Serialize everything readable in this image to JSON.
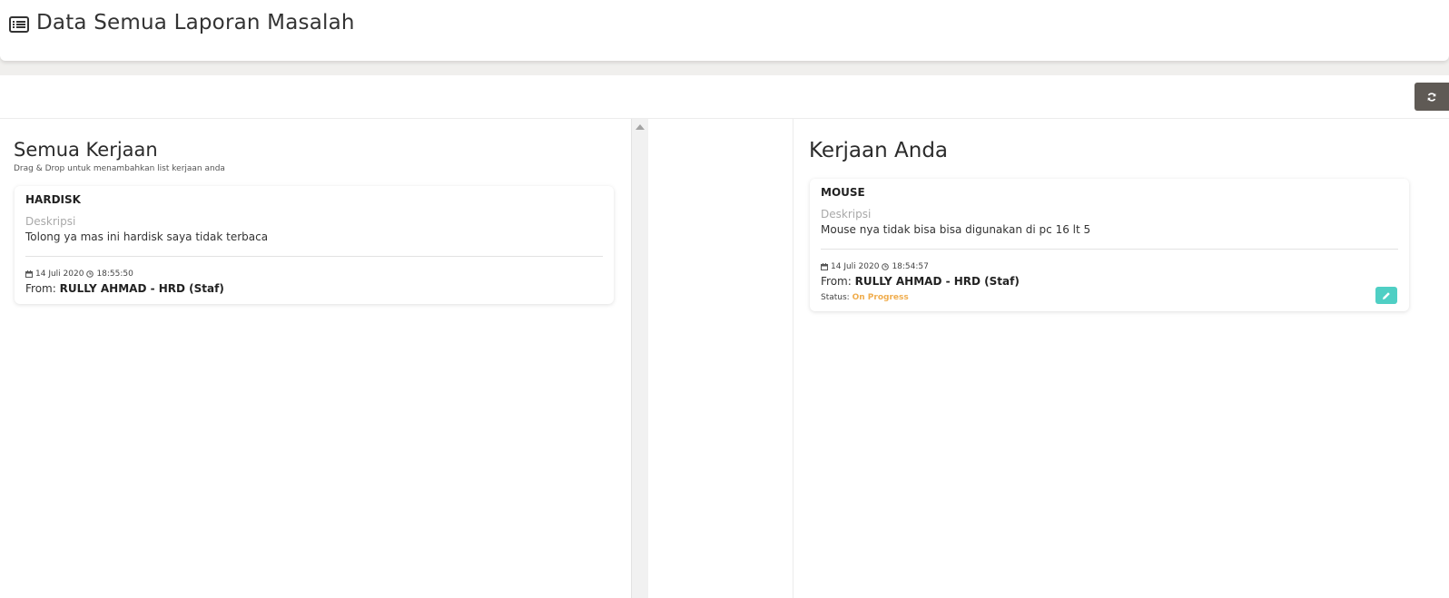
{
  "header": {
    "title": "Data Semua Laporan Masalah",
    "icon": "list-icon"
  },
  "toolbar": {
    "refresh_icon": "refresh-icon"
  },
  "left_panel": {
    "title": "Semua Kerjaan",
    "subtitle": "Drag & Drop untuk menambahkan list kerjaan anda",
    "cards": [
      {
        "title": "HARDISK",
        "desc_label": "Deskripsi",
        "description": "Tolong ya mas ini hardisk saya tidak terbaca",
        "date": "14 Juli 2020",
        "time": "18:55:50",
        "from_label": "From:",
        "from_name": "RULLY AHMAD - HRD (Staf)"
      }
    ]
  },
  "right_panel": {
    "title": "Kerjaan Anda",
    "cards": [
      {
        "title": "MOUSE",
        "desc_label": "Deskripsi",
        "description": "Mouse nya tidak bisa bisa digunakan di pc 16 lt 5",
        "date": "14 Juli 2020",
        "time": "18:54:57",
        "from_label": "From:",
        "from_name": "RULLY AHMAD - HRD (Staf)",
        "status_label": "Status:",
        "status_value": "On Progress",
        "status_color": "#f0ad4e"
      }
    ]
  },
  "colors": {
    "accent_edit": "#4fcfc4",
    "refresh_bg": "#5f5a55"
  }
}
